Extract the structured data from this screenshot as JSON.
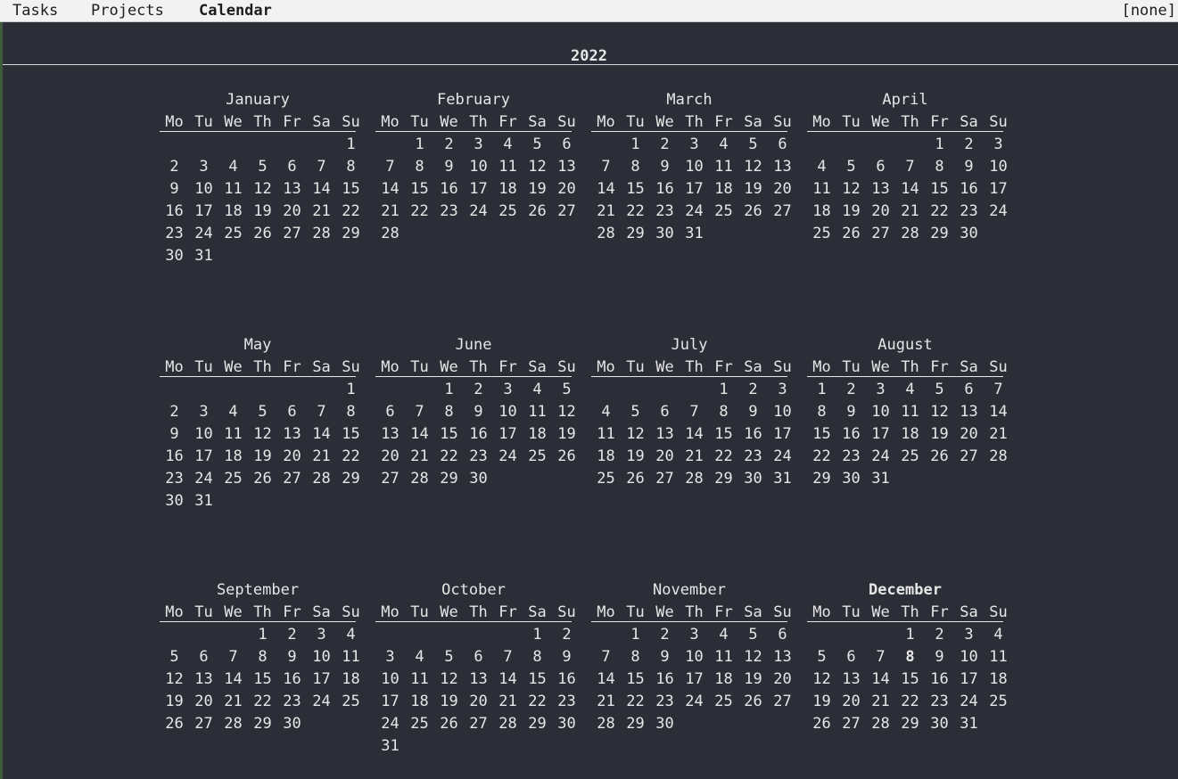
{
  "tabs": [
    {
      "label": "Tasks"
    },
    {
      "label": "Projects"
    },
    {
      "label": "Calendar",
      "active": true
    }
  ],
  "filter_label": "[none]",
  "year": "2022",
  "weekdays": [
    "Mo",
    "Tu",
    "We",
    "Th",
    "Fr",
    "Sa",
    "Su"
  ],
  "months": [
    {
      "name": "January",
      "first_weekday": 6,
      "days": 31
    },
    {
      "name": "February",
      "first_weekday": 1,
      "days": 28
    },
    {
      "name": "March",
      "first_weekday": 1,
      "days": 31
    },
    {
      "name": "April",
      "first_weekday": 4,
      "days": 30
    },
    {
      "name": "May",
      "first_weekday": 6,
      "days": 31
    },
    {
      "name": "June",
      "first_weekday": 2,
      "days": 30
    },
    {
      "name": "July",
      "first_weekday": 4,
      "days": 31
    },
    {
      "name": "August",
      "first_weekday": 0,
      "days": 31
    },
    {
      "name": "September",
      "first_weekday": 3,
      "days": 30
    },
    {
      "name": "October",
      "first_weekday": 5,
      "days": 31
    },
    {
      "name": "November",
      "first_weekday": 1,
      "days": 30
    },
    {
      "name": "December",
      "first_weekday": 3,
      "days": 31,
      "current": true,
      "today": 8
    }
  ],
  "colors": {
    "background": "#2b2e37",
    "text": "#e6e6e6",
    "topbar": "#f2f2f2"
  }
}
